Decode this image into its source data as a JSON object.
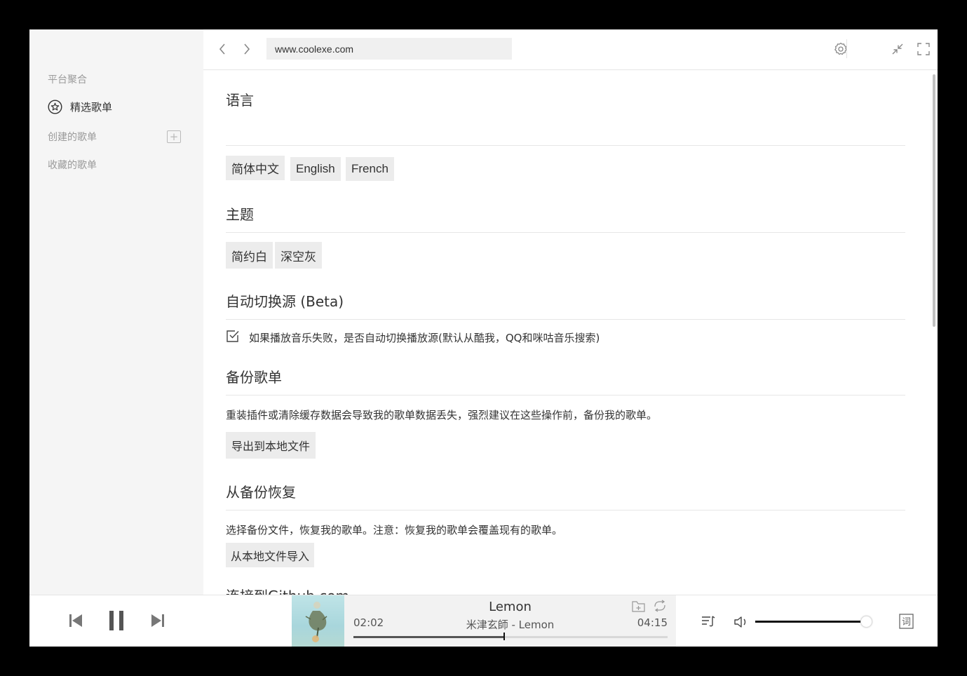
{
  "sidebar": {
    "section_platform": "平台聚合",
    "featured_label": "精选歌单",
    "created_label": "创建的歌单",
    "collected_label": "收藏的歌单"
  },
  "topbar": {
    "url": "www.coolexe.com"
  },
  "settings": {
    "language": {
      "title": "语言",
      "options": [
        "简体中文",
        "English",
        "French"
      ]
    },
    "theme": {
      "title": "主题",
      "options": [
        "简约白",
        "深空灰"
      ]
    },
    "auto_switch": {
      "title": "自动切换源 (Beta)",
      "checkbox_label": "如果播放音乐失败，是否自动切换播放源(默认从酷我，QQ和咪咕音乐搜索)",
      "checked": true
    },
    "backup": {
      "title": "备份歌单",
      "description": "重装插件或清除缓存数据会导致我的歌单数据丢失，强烈建议在这些操作前，备份我的歌单。",
      "button": "导出到本地文件"
    },
    "restore": {
      "title": "从备份恢复",
      "description": "选择备份文件，恢复我的歌单。注意：恢复我的歌单会覆盖现有的歌单。",
      "button": "从本地文件导入"
    },
    "github": {
      "title": "连接到Github.com"
    }
  },
  "player": {
    "title": "Lemon",
    "artist_line": "米津玄師 - Lemon",
    "current_time": "02:02",
    "total_time": "04:15",
    "progress": 0.48,
    "volume": 0.97,
    "lyric_button": "词"
  },
  "icons": {
    "back": "chevron-left-icon",
    "forward": "chevron-right-icon",
    "settings": "gear-icon",
    "minimize": "minimize-icon",
    "fullscreen": "fullscreen-icon",
    "close": "close-icon",
    "featured": "star-circle-icon",
    "add_playlist": "plus-square-icon",
    "checkbox": "checkbox-checked-icon",
    "prev": "skip-back-icon",
    "pause": "pause-icon",
    "next": "skip-forward-icon",
    "add_to_playlist": "folder-plus-icon",
    "repeat": "repeat-icon",
    "playlist": "playlist-icon",
    "volume": "volume-icon",
    "lyric": "lyric-icon"
  }
}
